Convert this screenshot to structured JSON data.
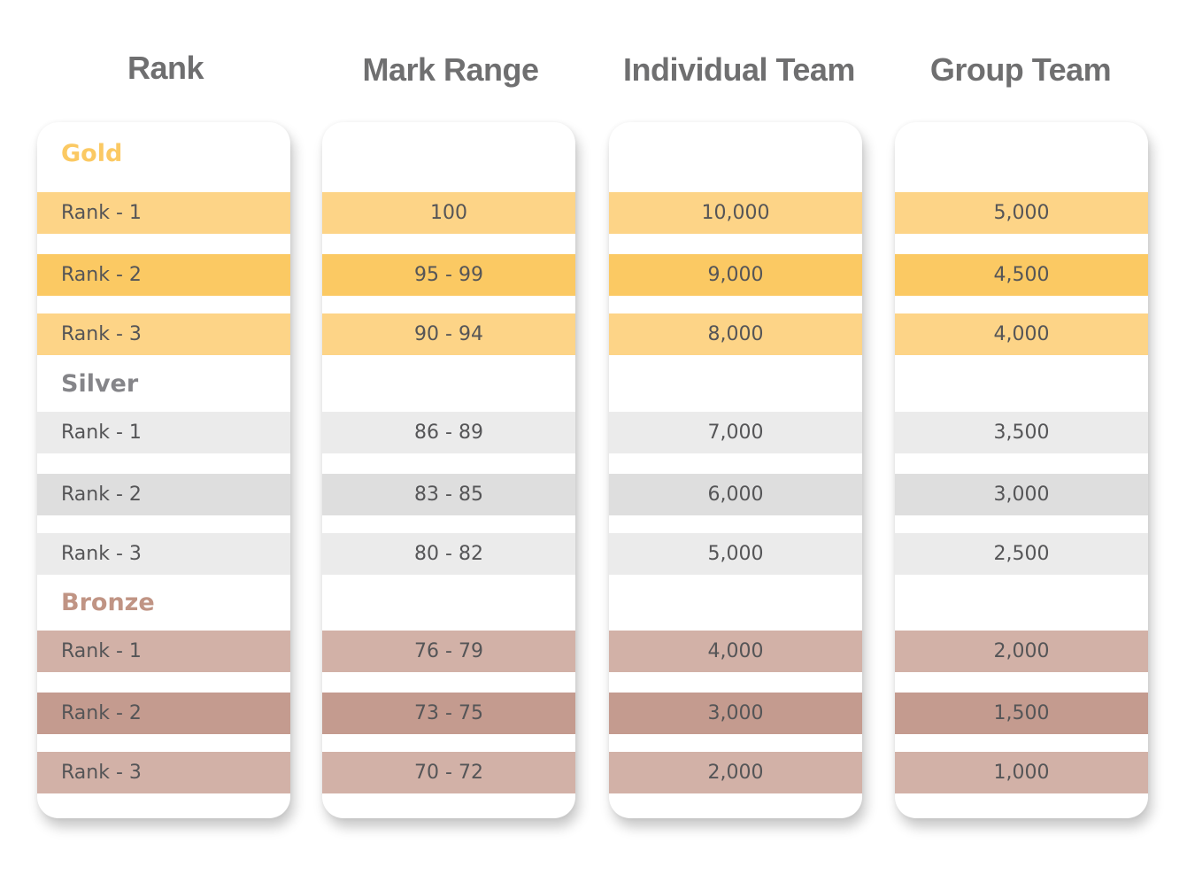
{
  "headers": {
    "rank": "Rank",
    "mark_range": "Mark Range",
    "individual_team": "Individual Team",
    "group_team": "Group Team"
  },
  "tier_colors": {
    "gold": "#fbc963",
    "silver": "#858589",
    "bronze": "#c09484"
  },
  "tiers": [
    {
      "name": "Gold",
      "rows": [
        {
          "rank": "Rank - 1",
          "mark_range": "100",
          "individual": "10,000",
          "group": "5,000"
        },
        {
          "rank": "Rank - 2",
          "mark_range": "95 - 99",
          "individual": "9,000",
          "group": "4,500"
        },
        {
          "rank": "Rank - 3",
          "mark_range": "90 - 94",
          "individual": "8,000",
          "group": "4,000"
        }
      ]
    },
    {
      "name": "Silver",
      "rows": [
        {
          "rank": "Rank - 1",
          "mark_range": "86 - 89",
          "individual": "7,000",
          "group": "3,500"
        },
        {
          "rank": "Rank - 2",
          "mark_range": "83 - 85",
          "individual": "6,000",
          "group": "3,000"
        },
        {
          "rank": "Rank - 3",
          "mark_range": "80 - 82",
          "individual": "5,000",
          "group": "2,500"
        }
      ]
    },
    {
      "name": "Bronze",
      "rows": [
        {
          "rank": "Rank - 1",
          "mark_range": "76 - 79",
          "individual": "4,000",
          "group": "2,000"
        },
        {
          "rank": "Rank - 2",
          "mark_range": "73 - 75",
          "individual": "3,000",
          "group": "1,500"
        },
        {
          "rank": "Rank - 3",
          "mark_range": "70 - 72",
          "individual": "2,000",
          "group": "1,000"
        }
      ]
    }
  ]
}
